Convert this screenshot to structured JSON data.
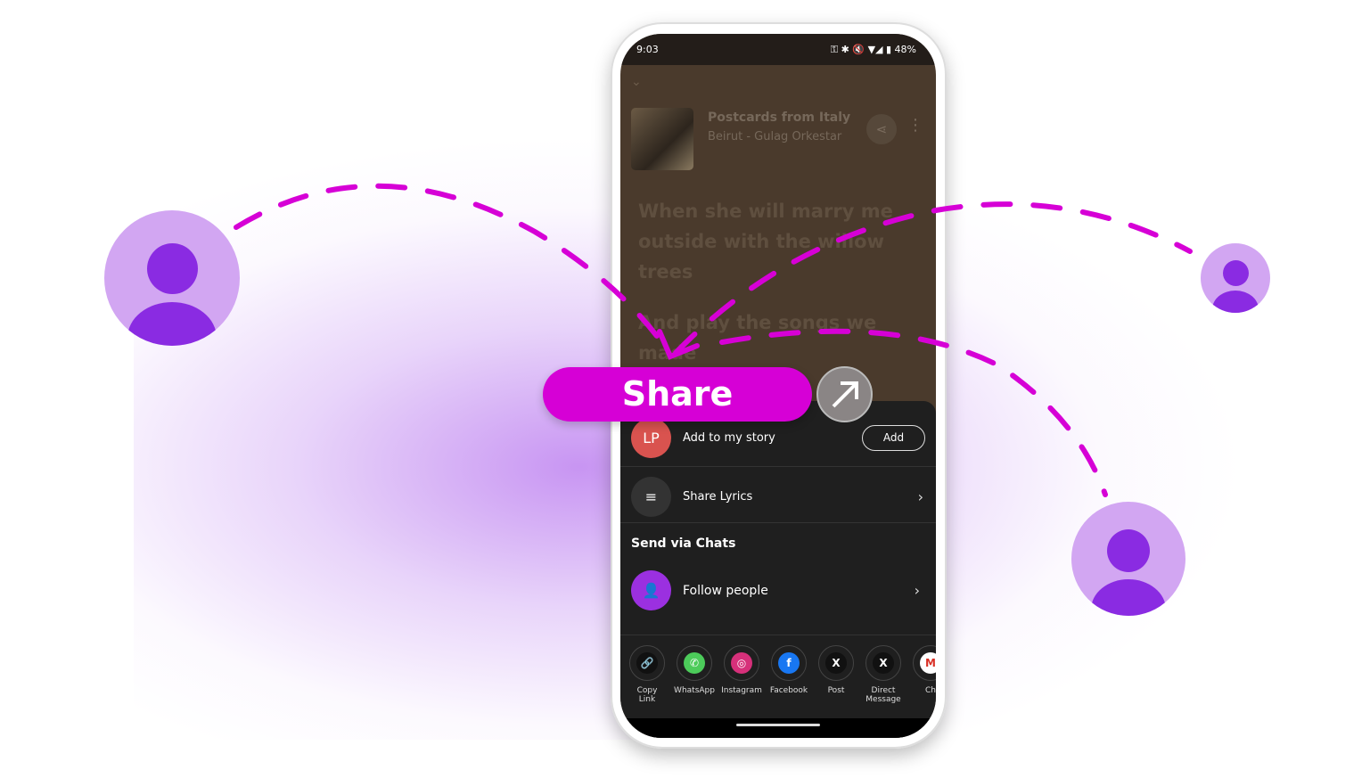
{
  "status_bar": {
    "time": "9:03",
    "battery": "48%"
  },
  "now_playing": {
    "title": "Postcards from Italy",
    "artist": "Beirut - Gulag Orkestar"
  },
  "lyrics": [
    "When she will marry me",
    "outside with the willow",
    "trees",
    "And play the songs we",
    "made"
  ],
  "share_sheet": {
    "story": {
      "avatar_initials": "LP",
      "label": "Add to my story",
      "button": "Add"
    },
    "share_lyrics": "Share Lyrics",
    "section_title": "Send via Chats",
    "follow_people": "Follow people",
    "apps": [
      {
        "label": "Copy Link",
        "icon": "link-icon",
        "color": "#111111"
      },
      {
        "label": "WhatsApp",
        "icon": "whatsapp-icon",
        "color": "#4ccb5a"
      },
      {
        "label": "Instagram",
        "icon": "instagram-icon",
        "color": "#d6307a"
      },
      {
        "label": "Facebook",
        "icon": "facebook-icon",
        "color": "#1877f2"
      },
      {
        "label": "Post",
        "icon": "x-icon",
        "color": "#111111"
      },
      {
        "label": "Direct Message",
        "icon": "x-icon",
        "color": "#111111"
      },
      {
        "label": "Ch",
        "icon": "gmail-icon",
        "color": "#ffffff"
      }
    ]
  },
  "banner": {
    "label": "Share",
    "accent": "#d600d6"
  },
  "colors": {
    "avatar_bg": "#d2a6f2",
    "avatar_fg": "#8a2be2",
    "line": "#d600d6"
  }
}
